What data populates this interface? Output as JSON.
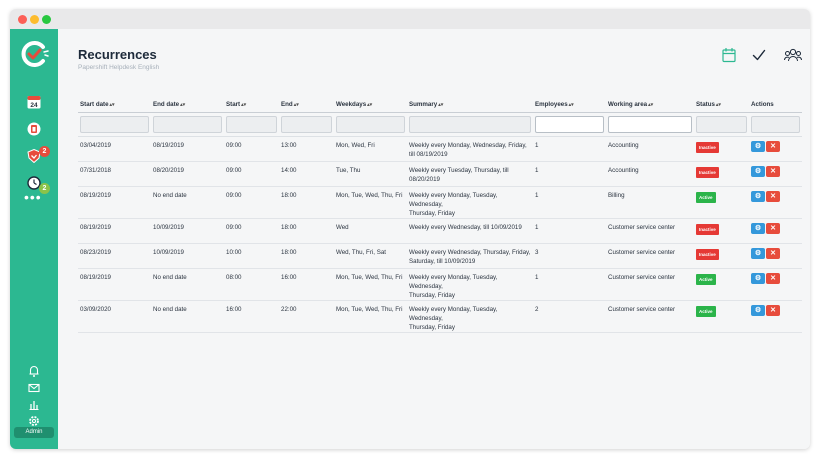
{
  "header": {
    "title": "Recurrences",
    "subtitle": "Papershift Helpdesk English"
  },
  "sidebar": {
    "calendar_day": "24",
    "badges": [
      "2",
      "2"
    ],
    "more": "•••",
    "user_label": "Admin"
  },
  "colors": {
    "brand": "#2cb891",
    "inactive": "#e53935",
    "active": "#2bb44a",
    "edit": "#3498db",
    "delete": "#e74c3c"
  },
  "table": {
    "columns": [
      "Start date",
      "End date",
      "Start",
      "End",
      "Weekdays",
      "Summary",
      "Employees",
      "Working area",
      "Status",
      "Actions"
    ],
    "rows": [
      {
        "start_date": "03/04/2019",
        "end_date": "08/19/2019",
        "start": "09:00",
        "end": "13:00",
        "weekdays": "Mon, Wed, Fri",
        "summary": [
          "Weekly every Monday, Wednesday, Friday,",
          "till 08/19/2019"
        ],
        "employees": "1",
        "area": "Accounting",
        "status": "Inactive",
        "status_key": "inactive"
      },
      {
        "start_date": "07/31/2018",
        "end_date": "08/20/2019",
        "start": "09:00",
        "end": "14:00",
        "weekdays": "Tue, Thu",
        "summary": [
          "Weekly every Tuesday, Thursday, till",
          "08/20/2019"
        ],
        "employees": "1",
        "area": "Accounting",
        "status": "Inactive",
        "status_key": "inactive"
      },
      {
        "start_date": "08/19/2019",
        "end_date": "No end date",
        "start": "09:00",
        "end": "18:00",
        "weekdays": "Mon, Tue, Wed, Thu, Fri",
        "summary": [
          "Weekly every Monday, Tuesday, Wednesday,",
          "Thursday, Friday"
        ],
        "employees": "1",
        "area": "Billing",
        "status": "Active",
        "status_key": "active"
      },
      {
        "start_date": "08/19/2019",
        "end_date": "10/09/2019",
        "start": "09:00",
        "end": "18:00",
        "weekdays": "Wed",
        "summary": [
          "Weekly every Wednesday, till 10/09/2019"
        ],
        "employees": "1",
        "area": "Customer service center",
        "status": "Inactive",
        "status_key": "inactive"
      },
      {
        "start_date": "08/23/2019",
        "end_date": "10/09/2019",
        "start": "10:00",
        "end": "18:00",
        "weekdays": "Wed, Thu, Fri, Sat",
        "summary": [
          "Weekly every Wednesday, Thursday, Friday,",
          "Saturday, till 10/09/2019"
        ],
        "employees": "3",
        "area": "Customer service center",
        "status": "Inactive",
        "status_key": "inactive"
      },
      {
        "start_date": "08/19/2019",
        "end_date": "No end date",
        "start": "08:00",
        "end": "16:00",
        "weekdays": "Mon, Tue, Wed, Thu, Fri",
        "summary": [
          "Weekly every Monday, Tuesday, Wednesday,",
          "Thursday, Friday"
        ],
        "employees": "1",
        "area": "Customer service center",
        "status": "Active",
        "status_key": "active"
      },
      {
        "start_date": "03/09/2020",
        "end_date": "No end date",
        "start": "16:00",
        "end": "22:00",
        "weekdays": "Mon, Tue, Wed, Thu, Fri",
        "summary": [
          "Weekly every Monday, Tuesday, Wednesday,",
          "Thursday, Friday"
        ],
        "employees": "2",
        "area": "Customer service center",
        "status": "Active",
        "status_key": "active"
      }
    ]
  }
}
